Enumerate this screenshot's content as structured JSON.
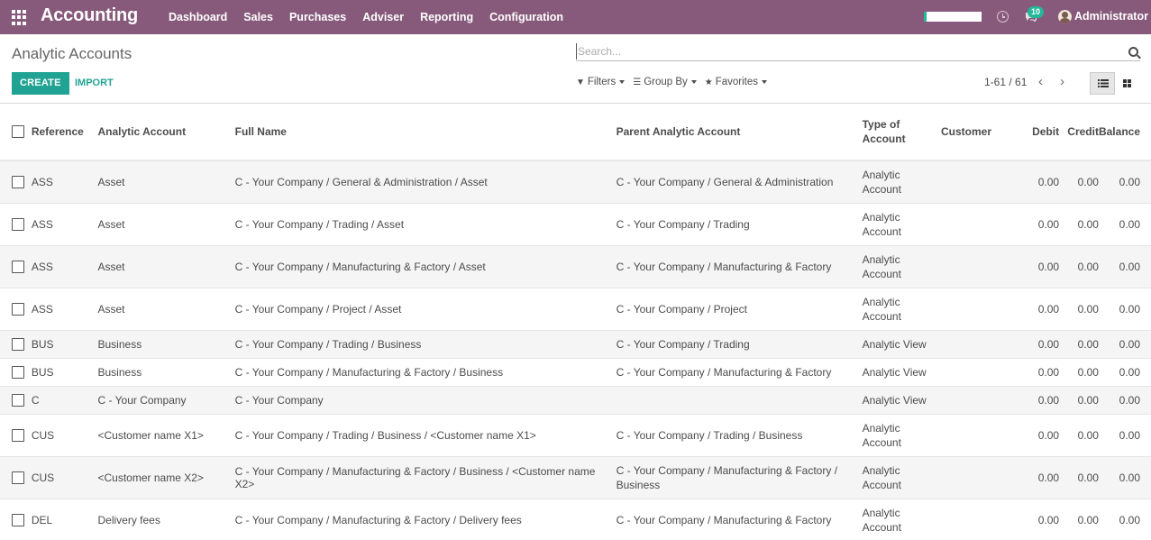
{
  "navbar": {
    "app_title": "Accounting",
    "menu": [
      "Dashboard",
      "Sales",
      "Purchases",
      "Adviser",
      "Reporting",
      "Configuration"
    ],
    "notification_count": "10",
    "user_name": "Administrator"
  },
  "control_panel": {
    "breadcrumb": "Analytic Accounts",
    "search_placeholder": "Search...",
    "create_label": "CREATE",
    "import_label": "IMPORT",
    "filters_label": "Filters",
    "group_by_label": "Group By",
    "favorites_label": "Favorites",
    "pager": "1-61 / 61"
  },
  "table": {
    "headers": {
      "reference": "Reference",
      "analytic_account": "Analytic Account",
      "full_name": "Full Name",
      "parent": "Parent Analytic Account",
      "type": "Type of Account",
      "customer": "Customer",
      "debit": "Debit",
      "credit": "Credit",
      "balance": "Balance"
    },
    "rows": [
      {
        "ref": "ASS",
        "account": "Asset",
        "full": "C - Your Company / General & Administration / Asset",
        "parent": "C - Your Company / General & Administration",
        "type": "Analytic Account",
        "customer": "",
        "debit": "0.00",
        "credit": "0.00",
        "balance": "0.00"
      },
      {
        "ref": "ASS",
        "account": "Asset",
        "full": "C - Your Company / Trading / Asset",
        "parent": "C - Your Company / Trading",
        "type": "Analytic Account",
        "customer": "",
        "debit": "0.00",
        "credit": "0.00",
        "balance": "0.00"
      },
      {
        "ref": "ASS",
        "account": "Asset",
        "full": "C - Your Company / Manufacturing & Factory / Asset",
        "parent": "C - Your Company / Manufacturing & Factory",
        "type": "Analytic Account",
        "customer": "",
        "debit": "0.00",
        "credit": "0.00",
        "balance": "0.00"
      },
      {
        "ref": "ASS",
        "account": "Asset",
        "full": "C - Your Company / Project / Asset",
        "parent": "C - Your Company / Project",
        "type": "Analytic Account",
        "customer": "",
        "debit": "0.00",
        "credit": "0.00",
        "balance": "0.00"
      },
      {
        "ref": "BUS",
        "account": "Business",
        "full": "C - Your Company / Trading / Business",
        "parent": "C - Your Company / Trading",
        "type": "Analytic View",
        "customer": "",
        "debit": "0.00",
        "credit": "0.00",
        "balance": "0.00"
      },
      {
        "ref": "BUS",
        "account": "Business",
        "full": "C - Your Company / Manufacturing & Factory / Business",
        "parent": "C - Your Company / Manufacturing & Factory",
        "type": "Analytic View",
        "customer": "",
        "debit": "0.00",
        "credit": "0.00",
        "balance": "0.00"
      },
      {
        "ref": "C",
        "account": "C - Your Company",
        "full": "C - Your Company",
        "parent": "",
        "type": "Analytic View",
        "customer": "",
        "debit": "0.00",
        "credit": "0.00",
        "balance": "0.00"
      },
      {
        "ref": "CUS",
        "account": "<Customer name X1>",
        "full": "C - Your Company / Trading / Business / <Customer name X1>",
        "parent": "C - Your Company / Trading / Business",
        "type": "Analytic Account",
        "customer": "",
        "debit": "0.00",
        "credit": "0.00",
        "balance": "0.00"
      },
      {
        "ref": "CUS",
        "account": "<Customer name X2>",
        "full": "C - Your Company / Manufacturing & Factory / Business / <Customer name X2>",
        "parent": "C - Your Company / Manufacturing & Factory / Business",
        "type": "Analytic Account",
        "customer": "",
        "debit": "0.00",
        "credit": "0.00",
        "balance": "0.00"
      },
      {
        "ref": "DEL",
        "account": "Delivery fees",
        "full": "C - Your Company / Manufacturing & Factory / Delivery fees",
        "parent": "C - Your Company / Manufacturing & Factory",
        "type": "Analytic Account",
        "customer": "",
        "debit": "0.00",
        "credit": "0.00",
        "balance": "0.00"
      }
    ]
  },
  "colors": {
    "navbar": "#875a7b",
    "primary_button": "#21a393",
    "badge": "#21b799"
  }
}
